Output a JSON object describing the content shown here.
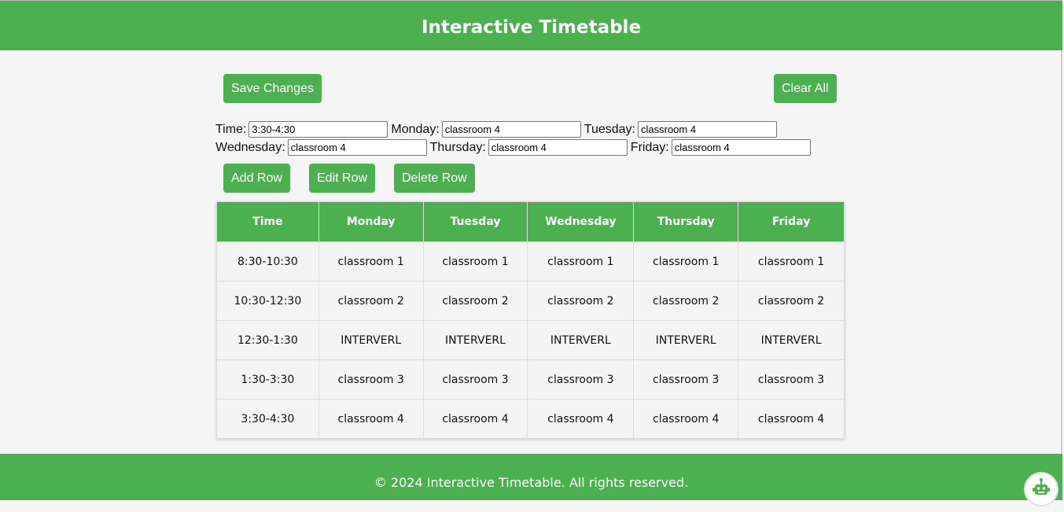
{
  "header": {
    "title": "Interactive Timetable"
  },
  "toolbar": {
    "save_label": "Save Changes",
    "clear_label": "Clear All"
  },
  "form": {
    "time_label": "Time:",
    "time_value": "3:30-4:30",
    "monday_label": "Monday:",
    "monday_value": "classroom 4",
    "tuesday_label": "Tuesday:",
    "tuesday_value": "classroom 4",
    "wednesday_label": "Wednesday:",
    "wednesday_value": "classroom 4",
    "thursday_label": "Thursday:",
    "thursday_value": "classroom 4",
    "friday_label": "Friday:",
    "friday_value": "classroom 4"
  },
  "actions": {
    "add_label": "Add Row",
    "edit_label": "Edit Row",
    "delete_label": "Delete Row"
  },
  "table": {
    "headers": [
      "Time",
      "Monday",
      "Tuesday",
      "Wednesday",
      "Thursday",
      "Friday"
    ],
    "rows": [
      [
        "8:30-10:30",
        "classroom 1",
        "classroom 1",
        "classroom 1",
        "classroom 1",
        "classroom 1"
      ],
      [
        "10:30-12:30",
        "classroom 2",
        "classroom 2",
        "classroom 2",
        "classroom 2",
        "classroom 2"
      ],
      [
        "12:30-1:30",
        "INTERVERL",
        "INTERVERL",
        "INTERVERL",
        "INTERVERL",
        "INTERVERL"
      ],
      [
        "1:30-3:30",
        "classroom 3",
        "classroom 3",
        "classroom 3",
        "classroom 3",
        "classroom 3"
      ],
      [
        "3:30-4:30",
        "classroom 4",
        "classroom 4",
        "classroom 4",
        "classroom 4",
        "classroom 4"
      ]
    ]
  },
  "footer": {
    "text": "© 2024 Interactive Timetable. All rights reserved."
  },
  "icons": {
    "assistant": "robot-assistant-icon"
  },
  "colors": {
    "accent": "#4caf50"
  }
}
